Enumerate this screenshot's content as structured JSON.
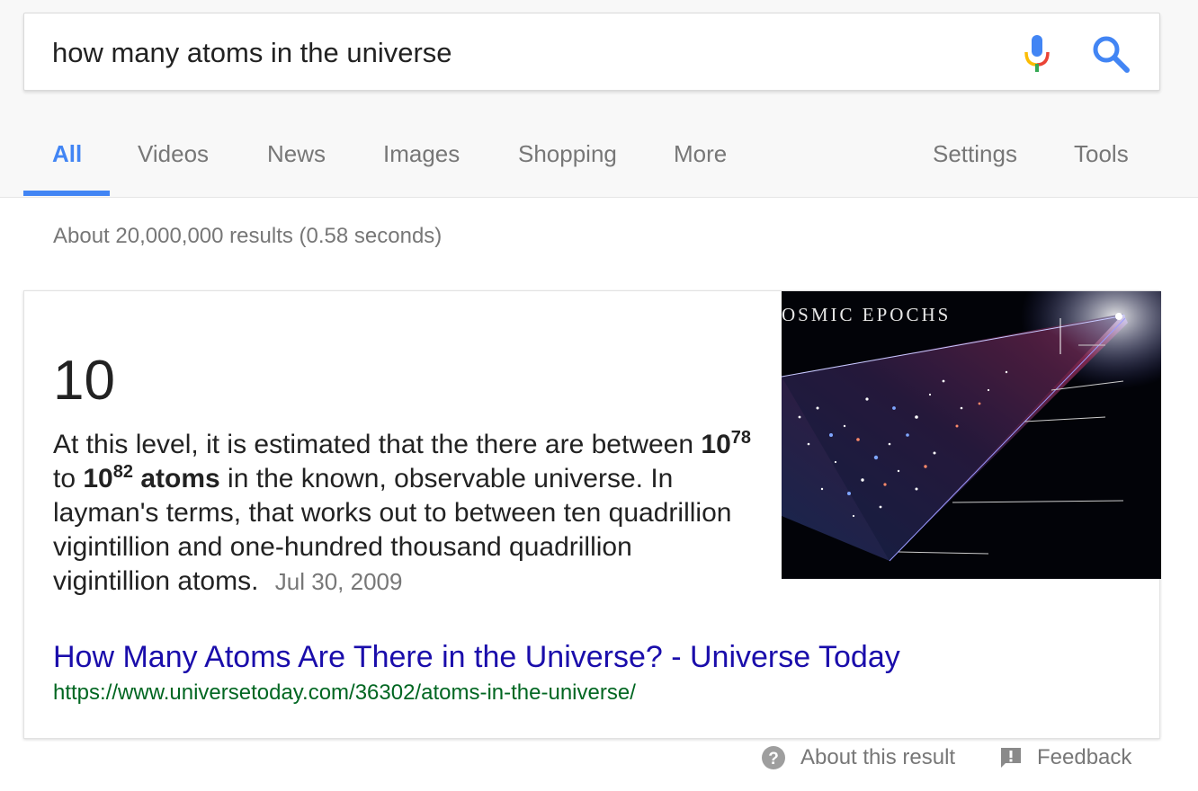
{
  "search": {
    "query": "how many atoms in the universe"
  },
  "icons": {
    "mic": "microphone-icon",
    "search": "magnifier-icon",
    "about": "question-circle-icon",
    "feedback": "feedback-icon"
  },
  "tabs": [
    {
      "label": "All",
      "active": true
    },
    {
      "label": "Videos"
    },
    {
      "label": "News"
    },
    {
      "label": "Images"
    },
    {
      "label": "Shopping"
    },
    {
      "label": "More"
    },
    {
      "label": "Settings"
    },
    {
      "label": "Tools"
    }
  ],
  "results_stats": "About 20,000,000 results (0.58 seconds)",
  "featured": {
    "answer": "10",
    "snippet": {
      "intro": "At this level, it is estimated that the there are between",
      "base1": "10",
      "exp1": "78",
      "to": "to",
      "base2": "10",
      "exp2": "82",
      "atoms": "atoms",
      "rest": "in the known, observable universe. In layman's terms, that works out to between ten quadrillion vigintillion and one-hundred thousand quadrillion vigintillion atoms.",
      "date": "Jul 30, 2009"
    },
    "image_caption": "OSMIC EPOCHS",
    "title": "How Many Atoms Are There in the Universe? - Universe Today",
    "url": "https://www.universetoday.com/36302/atoms-in-the-universe/"
  },
  "footer": {
    "about": "About this result",
    "feedback": "Feedback"
  },
  "colors": {
    "accent": "#4285f4",
    "link": "#1a0dab",
    "url": "#006621",
    "muted": "#777777"
  }
}
